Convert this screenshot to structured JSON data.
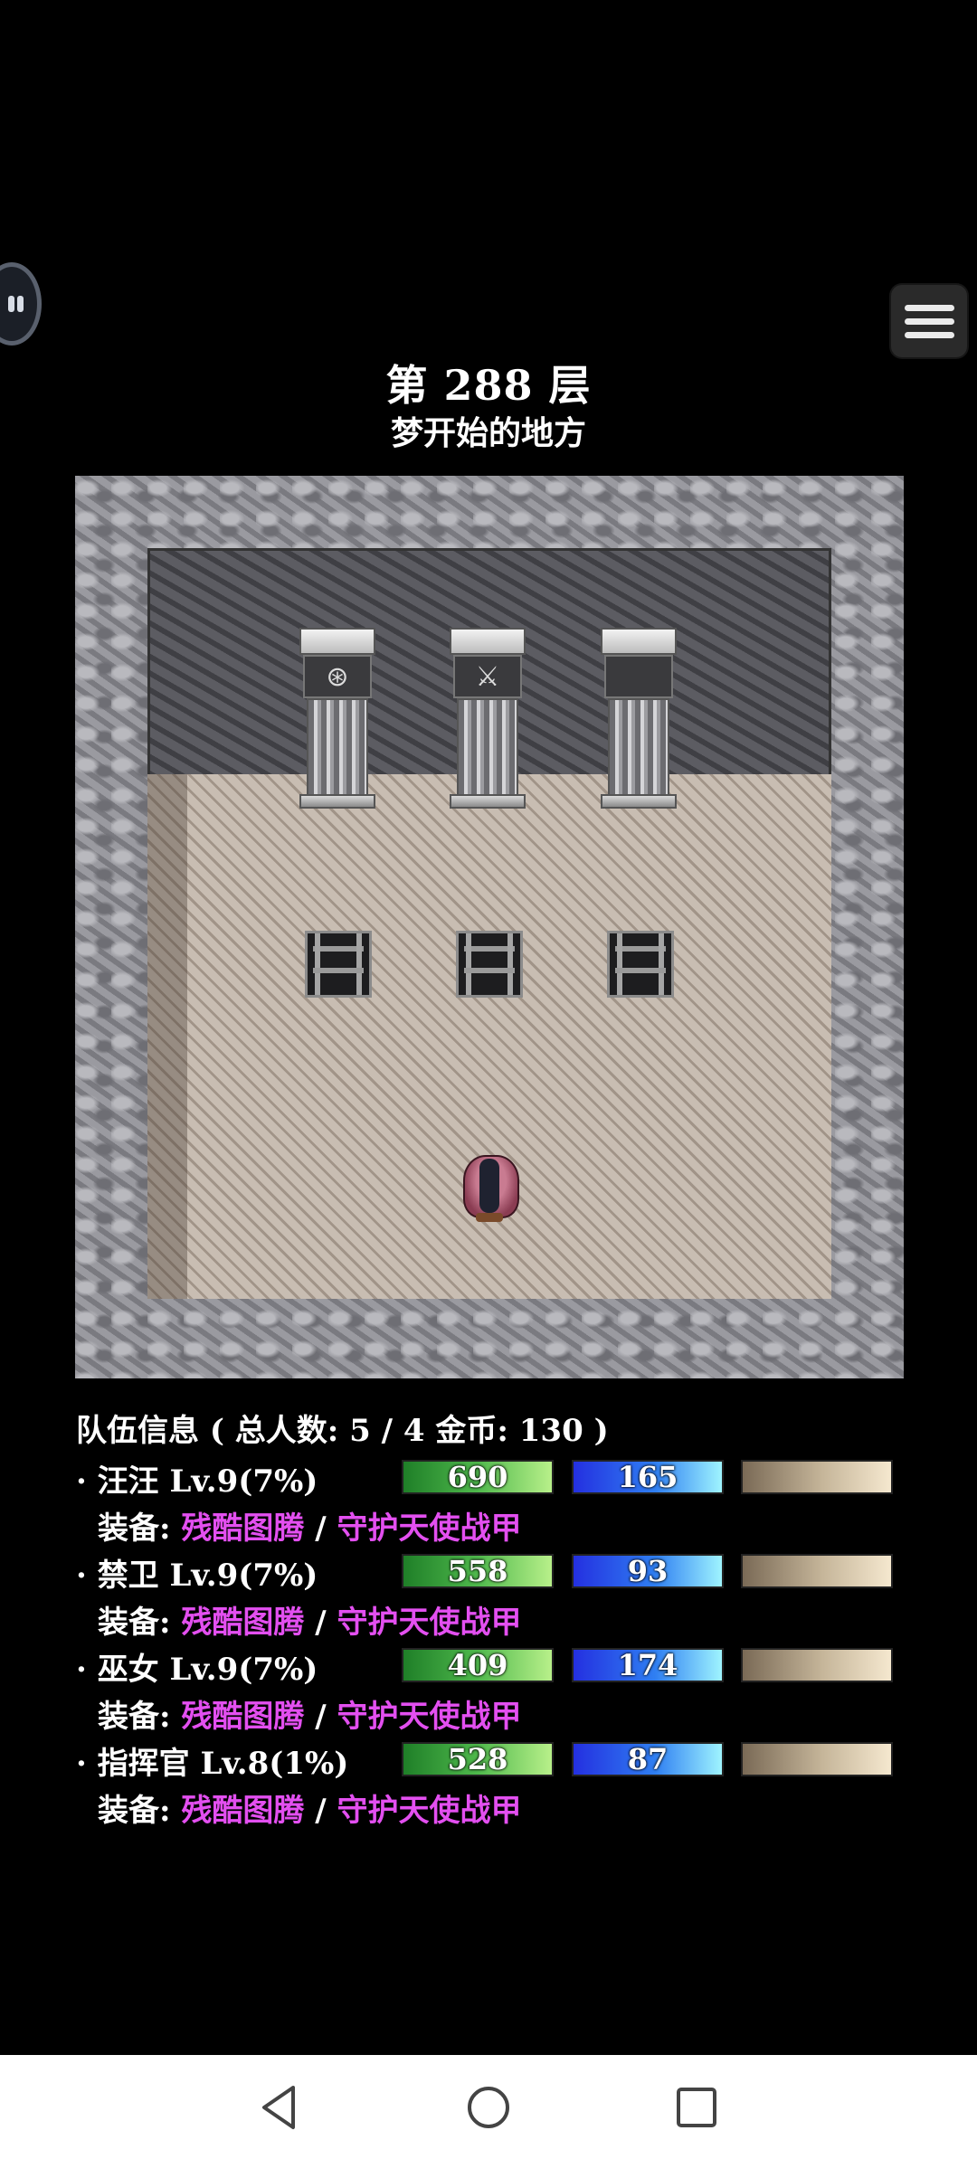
{
  "floor": {
    "title": "第 288 层",
    "subtitle": "梦开始的地方"
  },
  "overlay": {
    "assistant_icon": "floating-bubble-icon",
    "menu_icon": "hamburger-menu-icon"
  },
  "map": {
    "pillar_icons": [
      "rune-circle-icon",
      "sword-icon",
      "blank-icon"
    ],
    "pillar_glyphs": [
      "⊛",
      "⚔",
      ""
    ]
  },
  "party": {
    "header": "队伍信息 ( 总人数: 5 / 4 金币: 130 )",
    "members": [
      {
        "name": "· 汪汪 Lv.9(7%)",
        "hp": "690",
        "mp": "165",
        "equip_label": "装备: ",
        "weapon": "残酷图腾",
        "separator": " / ",
        "armor": "守护天使战甲"
      },
      {
        "name": "· 禁卫 Lv.9(7%)",
        "hp": "558",
        "mp": "93",
        "equip_label": "装备: ",
        "weapon": "残酷图腾",
        "separator": " / ",
        "armor": "守护天使战甲"
      },
      {
        "name": "· 巫女 Lv.9(7%)",
        "hp": "409",
        "mp": "174",
        "equip_label": "装备: ",
        "weapon": "残酷图腾",
        "separator": " / ",
        "armor": "守护天使战甲"
      },
      {
        "name": "· 指挥官 Lv.8(1%)",
        "hp": "528",
        "mp": "87",
        "equip_label": "装备: ",
        "weapon": "残酷图腾",
        "separator": " / ",
        "armor": "守护天使战甲"
      }
    ]
  },
  "colors": {
    "equip_item": "#e34ff0",
    "hp_bar": "#4fb94c",
    "mp_bar": "#2f7ff2",
    "xp_bar": "#c7b79b"
  },
  "navbar": {
    "icons": [
      "back-triangle-icon",
      "home-circle-icon",
      "recents-square-icon"
    ]
  }
}
